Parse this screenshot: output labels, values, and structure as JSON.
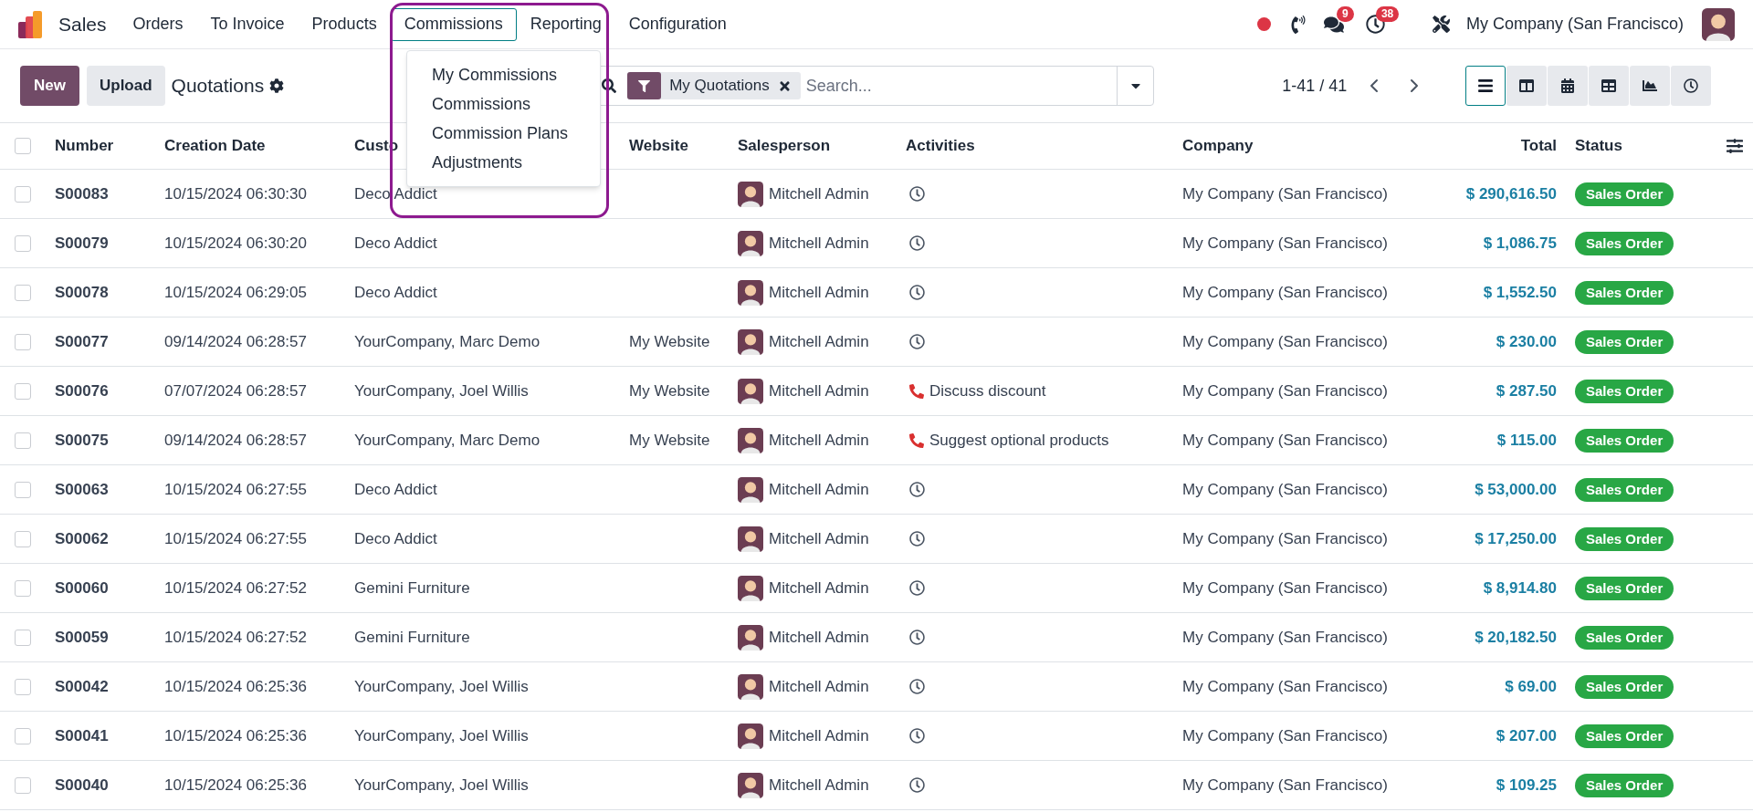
{
  "app": {
    "name": "Sales"
  },
  "menu": [
    {
      "label": "Orders",
      "selected": false
    },
    {
      "label": "To Invoice",
      "selected": false
    },
    {
      "label": "Products",
      "selected": false
    },
    {
      "label": "Commissions",
      "selected": true,
      "items": [
        "My Commissions",
        "Commissions",
        "Commission Plans",
        "Adjustments"
      ]
    },
    {
      "label": "Reporting",
      "selected": false
    },
    {
      "label": "Configuration",
      "selected": false
    }
  ],
  "systray": {
    "messages_badge": "9",
    "activities_badge": "38",
    "company": "My Company (San Francisco)"
  },
  "control_panel": {
    "new_button": "New",
    "upload_button": "Upload",
    "title": "Quotations",
    "search": {
      "facet": "My Quotations",
      "placeholder": "Search..."
    },
    "pager": "1-41 / 41",
    "views": [
      {
        "kind": "list",
        "selected": true
      },
      {
        "kind": "kanban",
        "selected": false
      },
      {
        "kind": "calendar",
        "selected": false
      },
      {
        "kind": "pivot",
        "selected": false
      },
      {
        "kind": "graph",
        "selected": false
      },
      {
        "kind": "activity",
        "selected": false
      }
    ]
  },
  "table": {
    "all_checked": false,
    "columns": [
      "Number",
      "Creation Date",
      "Custo",
      "Website",
      "Salesperson",
      "Activities",
      "Company",
      "Total",
      "Status"
    ],
    "rows": [
      {
        "checked": false,
        "number": "S00083",
        "date": "10/15/2024 06:30:30",
        "customer": "Deco Addict",
        "salesperson": "Mitchell Admin",
        "activity": {
          "kind": "clock"
        },
        "company": "My Company (San Francisco)",
        "total": "$ 290,616.50",
        "status": "Sales Order"
      },
      {
        "checked": false,
        "number": "S00079",
        "date": "10/15/2024 06:30:20",
        "customer": "Deco Addict",
        "salesperson": "Mitchell Admin",
        "activity": {
          "kind": "clock"
        },
        "company": "My Company (San Francisco)",
        "total": "$ 1,086.75",
        "status": "Sales Order"
      },
      {
        "checked": false,
        "number": "S00078",
        "date": "10/15/2024 06:29:05",
        "customer": "Deco Addict",
        "salesperson": "Mitchell Admin",
        "activity": {
          "kind": "clock"
        },
        "company": "My Company (San Francisco)",
        "total": "$ 1,552.50",
        "status": "Sales Order"
      },
      {
        "checked": false,
        "number": "S00077",
        "date": "09/14/2024 06:28:57",
        "customer": "YourCompany, Marc Demo",
        "website": "My Website",
        "salesperson": "Mitchell Admin",
        "activity": {
          "kind": "clock"
        },
        "company": "My Company (San Francisco)",
        "total": "$ 230.00",
        "status": "Sales Order"
      },
      {
        "checked": false,
        "number": "S00076",
        "date": "07/07/2024 06:28:57",
        "customer": "YourCompany, Joel Willis",
        "website": "My Website",
        "salesperson": "Mitchell Admin",
        "activity": {
          "kind": "call",
          "text": "Discuss discount"
        },
        "company": "My Company (San Francisco)",
        "total": "$ 287.50",
        "status": "Sales Order"
      },
      {
        "checked": false,
        "number": "S00075",
        "date": "09/14/2024 06:28:57",
        "customer": "YourCompany, Marc Demo",
        "website": "My Website",
        "salesperson": "Mitchell Admin",
        "activity": {
          "kind": "call",
          "text": "Suggest optional products"
        },
        "company": "My Company (San Francisco)",
        "total": "$ 115.00",
        "status": "Sales Order"
      },
      {
        "checked": false,
        "number": "S00063",
        "date": "10/15/2024 06:27:55",
        "customer": "Deco Addict",
        "salesperson": "Mitchell Admin",
        "activity": {
          "kind": "clock"
        },
        "company": "My Company (San Francisco)",
        "total": "$ 53,000.00",
        "status": "Sales Order"
      },
      {
        "checked": false,
        "number": "S00062",
        "date": "10/15/2024 06:27:55",
        "customer": "Deco Addict",
        "salesperson": "Mitchell Admin",
        "activity": {
          "kind": "clock"
        },
        "company": "My Company (San Francisco)",
        "total": "$ 17,250.00",
        "status": "Sales Order"
      },
      {
        "checked": false,
        "number": "S00060",
        "date": "10/15/2024 06:27:52",
        "customer": "Gemini Furniture",
        "salesperson": "Mitchell Admin",
        "activity": {
          "kind": "clock"
        },
        "company": "My Company (San Francisco)",
        "total": "$ 8,914.80",
        "status": "Sales Order"
      },
      {
        "checked": false,
        "number": "S00059",
        "date": "10/15/2024 06:27:52",
        "customer": "Gemini Furniture",
        "salesperson": "Mitchell Admin",
        "activity": {
          "kind": "clock"
        },
        "company": "My Company (San Francisco)",
        "total": "$ 20,182.50",
        "status": "Sales Order"
      },
      {
        "checked": false,
        "number": "S00042",
        "date": "10/15/2024 06:25:36",
        "customer": "YourCompany, Joel Willis",
        "salesperson": "Mitchell Admin",
        "activity": {
          "kind": "clock"
        },
        "company": "My Company (San Francisco)",
        "total": "$ 69.00",
        "status": "Sales Order"
      },
      {
        "checked": false,
        "number": "S00041",
        "date": "10/15/2024 06:25:36",
        "customer": "YourCompany, Joel Willis",
        "salesperson": "Mitchell Admin",
        "activity": {
          "kind": "clock"
        },
        "company": "My Company (San Francisco)",
        "total": "$ 207.00",
        "status": "Sales Order"
      },
      {
        "checked": false,
        "number": "S00040",
        "date": "10/15/2024 06:25:36",
        "customer": "YourCompany, Joel Willis",
        "salesperson": "Mitchell Admin",
        "activity": {
          "kind": "clock"
        },
        "company": "My Company (San Francisco)",
        "total": "$ 109.25",
        "status": "Sales Order"
      }
    ]
  }
}
